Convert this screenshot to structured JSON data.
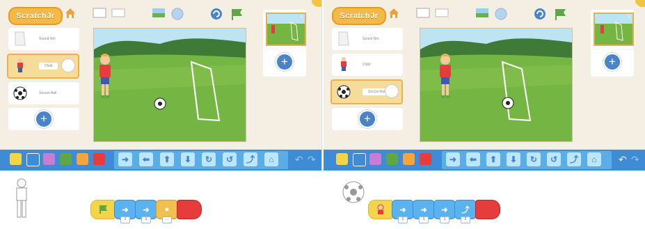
{
  "panels": [
    {
      "id": "left",
      "logo_text": "ScratchJr",
      "sprites": [
        {
          "name": "Sound Nm",
          "kind": "blank",
          "selected": false
        },
        {
          "name": "Child",
          "kind": "kid",
          "selected": true
        },
        {
          "name": "Soccer Ball",
          "kind": "ball",
          "selected": false
        }
      ],
      "page_num": "1",
      "script_sprite": "kid",
      "script": [
        "green-flag",
        "move-right",
        "move-right",
        "say",
        "end"
      ],
      "ball_pos": "ground"
    },
    {
      "id": "right",
      "logo_text": "ScratchJr",
      "sprites": [
        {
          "name": "Sound Nm",
          "kind": "blank",
          "selected": false
        },
        {
          "name": "Child",
          "kind": "kid",
          "selected": false
        },
        {
          "name": "Soccer Ball",
          "kind": "ball",
          "selected": true
        }
      ],
      "page_num": "1",
      "script_sprite": "ball",
      "script": [
        "on-bump",
        "move-right",
        "move-right",
        "move-right",
        "hop",
        "end"
      ],
      "ball_pos": "goal"
    }
  ],
  "colors": {
    "palette": "#3e8bd6",
    "accent": "#f4b946"
  },
  "icons": {
    "add": "+",
    "undo": "↶",
    "redo": "↷"
  }
}
